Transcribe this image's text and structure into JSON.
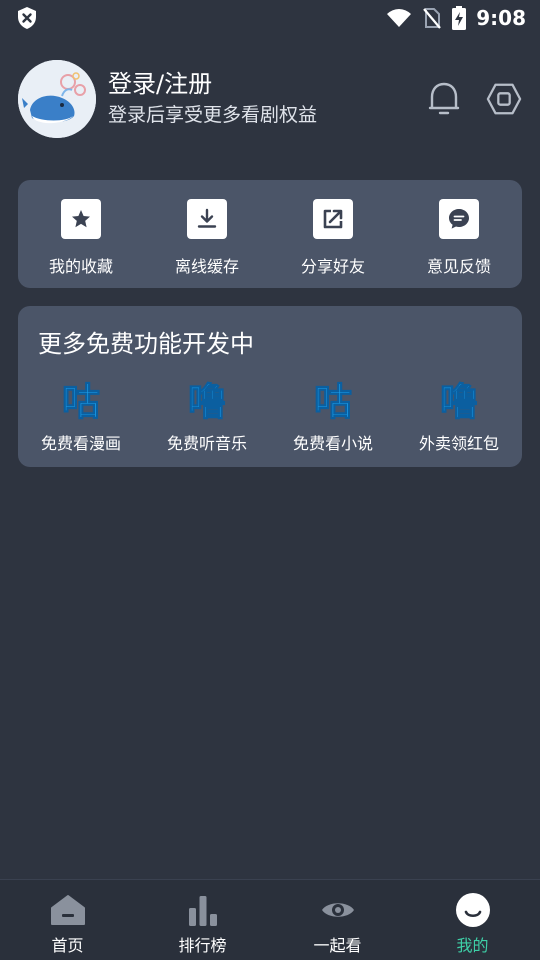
{
  "status_bar": {
    "time": "9:08",
    "icons": [
      "shield-x-icon",
      "wifi-icon",
      "no-sim-icon",
      "battery-charging-icon"
    ]
  },
  "profile": {
    "title": "登录/注册",
    "subtitle": "登录后享受更多看剧权益",
    "avatar_icon": "whale-avatar-icon",
    "actions": [
      "bell-icon",
      "settings-icon"
    ]
  },
  "quick_actions": [
    {
      "label": "我的收藏",
      "icon": "star-icon"
    },
    {
      "label": "离线缓存",
      "icon": "download-icon"
    },
    {
      "label": "分享好友",
      "icon": "share-icon"
    },
    {
      "label": "意见反馈",
      "icon": "feedback-icon"
    }
  ],
  "more_features": {
    "title": "更多免费功能开发中",
    "items": [
      {
        "glyph": "咕",
        "label": "免费看漫画"
      },
      {
        "glyph": "噜",
        "label": "免费听音乐"
      },
      {
        "glyph": "咕",
        "label": "免费看小说"
      },
      {
        "glyph": "噜",
        "label": "外卖领红包"
      }
    ]
  },
  "bottom_nav": [
    {
      "label": "首页",
      "icon": "home-icon",
      "active": false
    },
    {
      "label": "排行榜",
      "icon": "bar-chart-icon",
      "active": false
    },
    {
      "label": "一起看",
      "icon": "eye-icon",
      "active": false
    },
    {
      "label": "我的",
      "icon": "smile-icon",
      "active": true
    }
  ],
  "colors": {
    "background": "#2e3440",
    "card": "#4b5568",
    "accent": "#3ecfa7",
    "glyph": "#1ba3f2"
  }
}
